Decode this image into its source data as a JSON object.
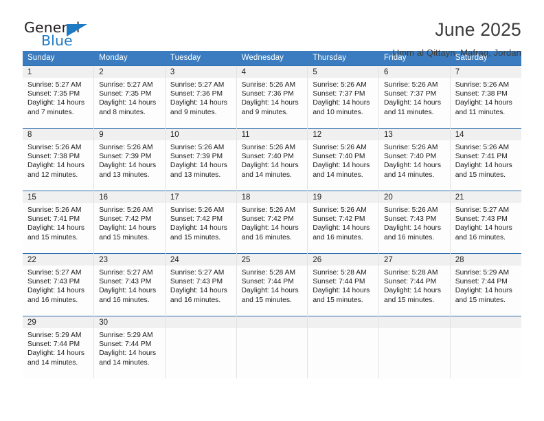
{
  "logo": {
    "word_one": "General",
    "word_two": "Blue",
    "triangle_icon": "triangle-icon",
    "accent_color": "#1f7ac4"
  },
  "header": {
    "title": "June 2025",
    "location": "Umm al Qittayn, Mafraq, Jordan"
  },
  "theme": {
    "header_blue": "#3a7cbf",
    "row_rule_blue": "#2f6fad",
    "daynum_bg": "#f0f0f0"
  },
  "weekdays": [
    "Sunday",
    "Monday",
    "Tuesday",
    "Wednesday",
    "Thursday",
    "Friday",
    "Saturday"
  ],
  "weeks": [
    [
      {
        "day": "1",
        "sunrise": "Sunrise: 5:27 AM",
        "sunset": "Sunset: 7:35 PM",
        "daylight_1": "Daylight: 14 hours",
        "daylight_2": "and 7 minutes."
      },
      {
        "day": "2",
        "sunrise": "Sunrise: 5:27 AM",
        "sunset": "Sunset: 7:35 PM",
        "daylight_1": "Daylight: 14 hours",
        "daylight_2": "and 8 minutes."
      },
      {
        "day": "3",
        "sunrise": "Sunrise: 5:27 AM",
        "sunset": "Sunset: 7:36 PM",
        "daylight_1": "Daylight: 14 hours",
        "daylight_2": "and 9 minutes."
      },
      {
        "day": "4",
        "sunrise": "Sunrise: 5:26 AM",
        "sunset": "Sunset: 7:36 PM",
        "daylight_1": "Daylight: 14 hours",
        "daylight_2": "and 9 minutes."
      },
      {
        "day": "5",
        "sunrise": "Sunrise: 5:26 AM",
        "sunset": "Sunset: 7:37 PM",
        "daylight_1": "Daylight: 14 hours",
        "daylight_2": "and 10 minutes."
      },
      {
        "day": "6",
        "sunrise": "Sunrise: 5:26 AM",
        "sunset": "Sunset: 7:37 PM",
        "daylight_1": "Daylight: 14 hours",
        "daylight_2": "and 11 minutes."
      },
      {
        "day": "7",
        "sunrise": "Sunrise: 5:26 AM",
        "sunset": "Sunset: 7:38 PM",
        "daylight_1": "Daylight: 14 hours",
        "daylight_2": "and 11 minutes."
      }
    ],
    [
      {
        "day": "8",
        "sunrise": "Sunrise: 5:26 AM",
        "sunset": "Sunset: 7:38 PM",
        "daylight_1": "Daylight: 14 hours",
        "daylight_2": "and 12 minutes."
      },
      {
        "day": "9",
        "sunrise": "Sunrise: 5:26 AM",
        "sunset": "Sunset: 7:39 PM",
        "daylight_1": "Daylight: 14 hours",
        "daylight_2": "and 13 minutes."
      },
      {
        "day": "10",
        "sunrise": "Sunrise: 5:26 AM",
        "sunset": "Sunset: 7:39 PM",
        "daylight_1": "Daylight: 14 hours",
        "daylight_2": "and 13 minutes."
      },
      {
        "day": "11",
        "sunrise": "Sunrise: 5:26 AM",
        "sunset": "Sunset: 7:40 PM",
        "daylight_1": "Daylight: 14 hours",
        "daylight_2": "and 14 minutes."
      },
      {
        "day": "12",
        "sunrise": "Sunrise: 5:26 AM",
        "sunset": "Sunset: 7:40 PM",
        "daylight_1": "Daylight: 14 hours",
        "daylight_2": "and 14 minutes."
      },
      {
        "day": "13",
        "sunrise": "Sunrise: 5:26 AM",
        "sunset": "Sunset: 7:40 PM",
        "daylight_1": "Daylight: 14 hours",
        "daylight_2": "and 14 minutes."
      },
      {
        "day": "14",
        "sunrise": "Sunrise: 5:26 AM",
        "sunset": "Sunset: 7:41 PM",
        "daylight_1": "Daylight: 14 hours",
        "daylight_2": "and 15 minutes."
      }
    ],
    [
      {
        "day": "15",
        "sunrise": "Sunrise: 5:26 AM",
        "sunset": "Sunset: 7:41 PM",
        "daylight_1": "Daylight: 14 hours",
        "daylight_2": "and 15 minutes."
      },
      {
        "day": "16",
        "sunrise": "Sunrise: 5:26 AM",
        "sunset": "Sunset: 7:42 PM",
        "daylight_1": "Daylight: 14 hours",
        "daylight_2": "and 15 minutes."
      },
      {
        "day": "17",
        "sunrise": "Sunrise: 5:26 AM",
        "sunset": "Sunset: 7:42 PM",
        "daylight_1": "Daylight: 14 hours",
        "daylight_2": "and 15 minutes."
      },
      {
        "day": "18",
        "sunrise": "Sunrise: 5:26 AM",
        "sunset": "Sunset: 7:42 PM",
        "daylight_1": "Daylight: 14 hours",
        "daylight_2": "and 16 minutes."
      },
      {
        "day": "19",
        "sunrise": "Sunrise: 5:26 AM",
        "sunset": "Sunset: 7:42 PM",
        "daylight_1": "Daylight: 14 hours",
        "daylight_2": "and 16 minutes."
      },
      {
        "day": "20",
        "sunrise": "Sunrise: 5:26 AM",
        "sunset": "Sunset: 7:43 PM",
        "daylight_1": "Daylight: 14 hours",
        "daylight_2": "and 16 minutes."
      },
      {
        "day": "21",
        "sunrise": "Sunrise: 5:27 AM",
        "sunset": "Sunset: 7:43 PM",
        "daylight_1": "Daylight: 14 hours",
        "daylight_2": "and 16 minutes."
      }
    ],
    [
      {
        "day": "22",
        "sunrise": "Sunrise: 5:27 AM",
        "sunset": "Sunset: 7:43 PM",
        "daylight_1": "Daylight: 14 hours",
        "daylight_2": "and 16 minutes."
      },
      {
        "day": "23",
        "sunrise": "Sunrise: 5:27 AM",
        "sunset": "Sunset: 7:43 PM",
        "daylight_1": "Daylight: 14 hours",
        "daylight_2": "and 16 minutes."
      },
      {
        "day": "24",
        "sunrise": "Sunrise: 5:27 AM",
        "sunset": "Sunset: 7:43 PM",
        "daylight_1": "Daylight: 14 hours",
        "daylight_2": "and 16 minutes."
      },
      {
        "day": "25",
        "sunrise": "Sunrise: 5:28 AM",
        "sunset": "Sunset: 7:44 PM",
        "daylight_1": "Daylight: 14 hours",
        "daylight_2": "and 15 minutes."
      },
      {
        "day": "26",
        "sunrise": "Sunrise: 5:28 AM",
        "sunset": "Sunset: 7:44 PM",
        "daylight_1": "Daylight: 14 hours",
        "daylight_2": "and 15 minutes."
      },
      {
        "day": "27",
        "sunrise": "Sunrise: 5:28 AM",
        "sunset": "Sunset: 7:44 PM",
        "daylight_1": "Daylight: 14 hours",
        "daylight_2": "and 15 minutes."
      },
      {
        "day": "28",
        "sunrise": "Sunrise: 5:29 AM",
        "sunset": "Sunset: 7:44 PM",
        "daylight_1": "Daylight: 14 hours",
        "daylight_2": "and 15 minutes."
      }
    ],
    [
      {
        "day": "29",
        "sunrise": "Sunrise: 5:29 AM",
        "sunset": "Sunset: 7:44 PM",
        "daylight_1": "Daylight: 14 hours",
        "daylight_2": "and 14 minutes."
      },
      {
        "day": "30",
        "sunrise": "Sunrise: 5:29 AM",
        "sunset": "Sunset: 7:44 PM",
        "daylight_1": "Daylight: 14 hours",
        "daylight_2": "and 14 minutes."
      },
      {
        "day": "",
        "sunrise": "",
        "sunset": "",
        "daylight_1": "",
        "daylight_2": ""
      },
      {
        "day": "",
        "sunrise": "",
        "sunset": "",
        "daylight_1": "",
        "daylight_2": ""
      },
      {
        "day": "",
        "sunrise": "",
        "sunset": "",
        "daylight_1": "",
        "daylight_2": ""
      },
      {
        "day": "",
        "sunrise": "",
        "sunset": "",
        "daylight_1": "",
        "daylight_2": ""
      },
      {
        "day": "",
        "sunrise": "",
        "sunset": "",
        "daylight_1": "",
        "daylight_2": ""
      }
    ]
  ]
}
